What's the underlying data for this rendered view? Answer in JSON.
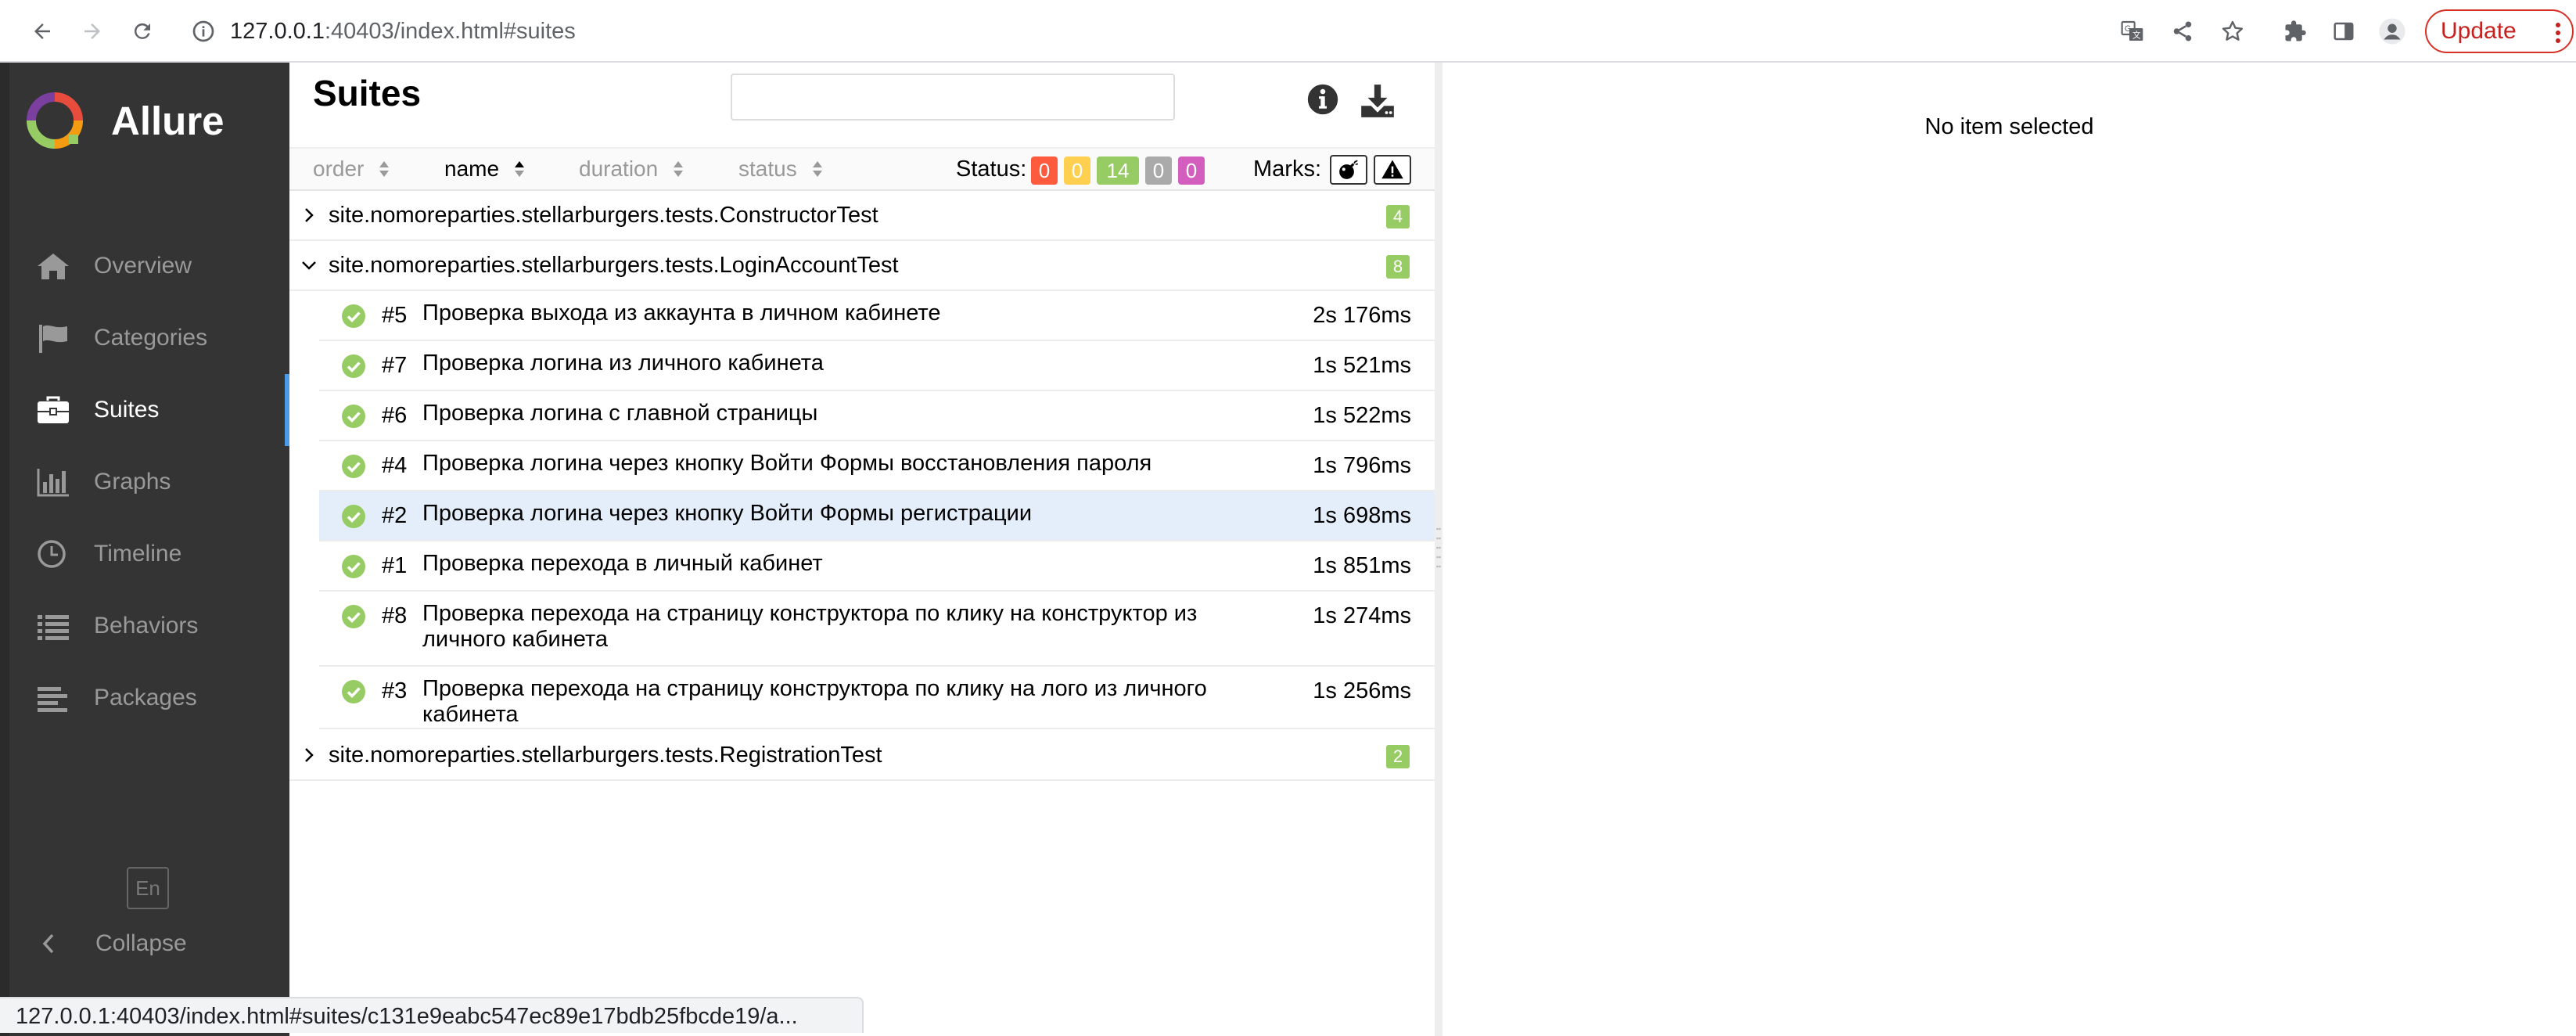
{
  "browser": {
    "url_host": "127.0.0.1",
    "url_rest": ":40403/index.html#suites",
    "update_label": "Update",
    "status_url": "127.0.0.1:40403/index.html#suites/c131e9eabc547ec89e17bdb25fbcde19/a..."
  },
  "sidebar": {
    "brand": "Allure",
    "items": [
      {
        "label": "Overview",
        "icon": "home-icon"
      },
      {
        "label": "Categories",
        "icon": "flag-icon"
      },
      {
        "label": "Suites",
        "icon": "briefcase-icon",
        "active": true
      },
      {
        "label": "Graphs",
        "icon": "bar-chart-icon"
      },
      {
        "label": "Timeline",
        "icon": "clock-icon"
      },
      {
        "label": "Behaviors",
        "icon": "list-icon"
      },
      {
        "label": "Packages",
        "icon": "align-left-icon"
      }
    ],
    "language": "En",
    "collapse": "Collapse"
  },
  "main": {
    "title": "Suites",
    "search_value": "",
    "sort": {
      "order": "order",
      "name": "name",
      "duration": "duration",
      "status": "status"
    },
    "status_label": "Status:",
    "status_counts": [
      {
        "value": "0",
        "color": "#fd5a3e"
      },
      {
        "value": "0",
        "color": "#ffd050"
      },
      {
        "value": "14",
        "color": "#97cc64"
      },
      {
        "value": "0",
        "color": "#aaaaaa"
      },
      {
        "value": "0",
        "color": "#d35ebe"
      }
    ],
    "marks_label": "Marks:",
    "suites": [
      {
        "name": "site.nomoreparties.stellarburgers.tests.ConstructorTest",
        "count": "4",
        "expanded": false
      },
      {
        "name": "site.nomoreparties.stellarburgers.tests.LoginAccountTest",
        "count": "8",
        "expanded": true
      },
      {
        "name": "site.nomoreparties.stellarburgers.tests.RegistrationTest",
        "count": "2",
        "expanded": false
      }
    ],
    "tests": [
      {
        "num": "#5",
        "title": "Проверка выхода из аккаунта в личном кабинете",
        "duration": "2s 176ms"
      },
      {
        "num": "#7",
        "title": "Проверка логина из личного кабинета",
        "duration": "1s 521ms"
      },
      {
        "num": "#6",
        "title": "Проверка логина с главной страницы",
        "duration": "1s 522ms"
      },
      {
        "num": "#4",
        "title": "Проверка логина через кнопку Войти Формы восстановления пароля",
        "duration": "1s 796ms"
      },
      {
        "num": "#2",
        "title": "Проверка логина через кнопку Войти Формы регистрации",
        "duration": "1s 698ms",
        "selected": true
      },
      {
        "num": "#1",
        "title": "Проверка перехода в личный кабинет",
        "duration": "1s 851ms"
      },
      {
        "num": "#8",
        "title": "Проверка перехода на страницу конструктора по клику на конструктор из личного кабинета",
        "duration": "1s 274ms"
      },
      {
        "num": "#3",
        "title": "Проверка перехода на страницу конструктора по клику на лого из личного кабинета",
        "duration": "1s 256ms"
      }
    ]
  },
  "detail": {
    "empty": "No item selected"
  }
}
